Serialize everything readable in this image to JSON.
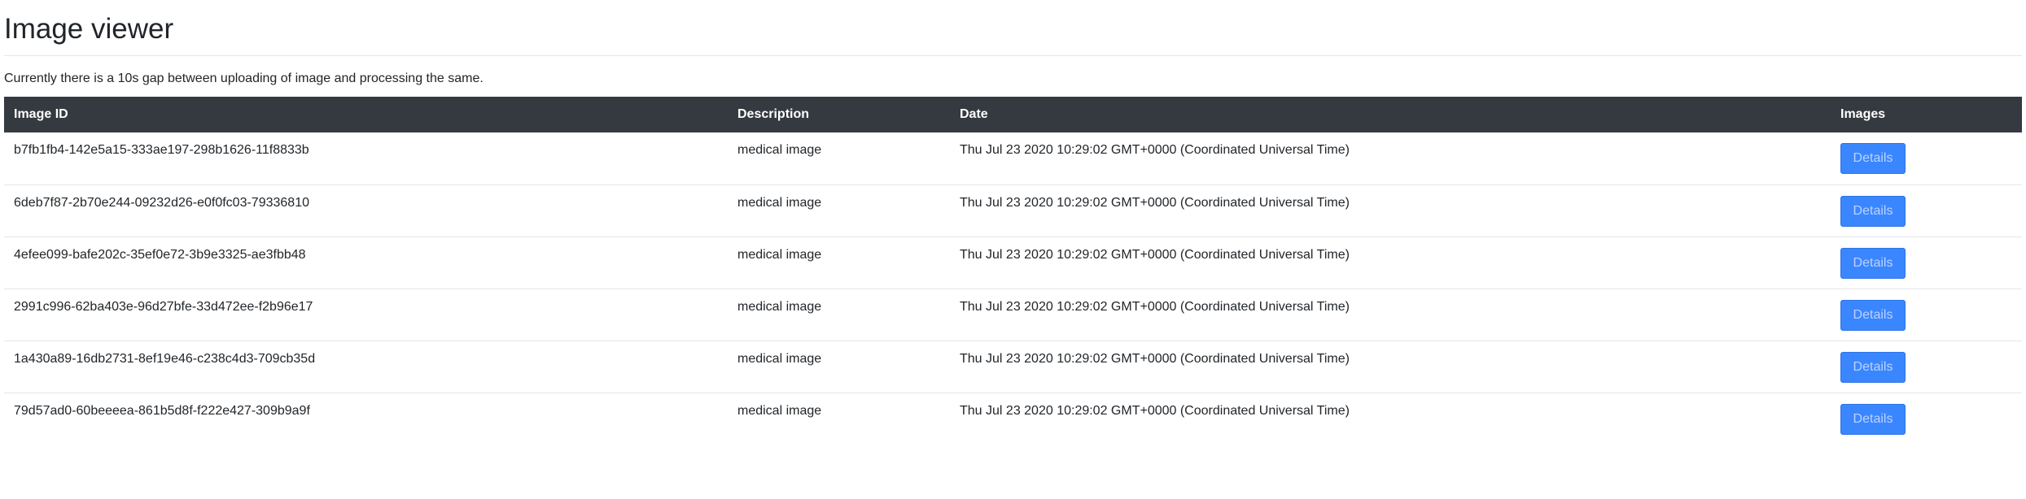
{
  "page": {
    "title": "Image viewer",
    "notice": "Currently there is a 10s gap between uploading of image and processing the same."
  },
  "table": {
    "headers": {
      "id": "Image ID",
      "description": "Description",
      "date": "Date",
      "images": "Images"
    },
    "rows": [
      {
        "id": "b7fb1fb4-142e5a15-333ae197-298b1626-11f8833b",
        "description": "medical image",
        "date": "Thu Jul 23 2020 10:29:02 GMT+0000 (Coordinated Universal Time)",
        "button": "Details"
      },
      {
        "id": "6deb7f87-2b70e244-09232d26-e0f0fc03-79336810",
        "description": "medical image",
        "date": "Thu Jul 23 2020 10:29:02 GMT+0000 (Coordinated Universal Time)",
        "button": "Details"
      },
      {
        "id": "4efee099-bafe202c-35ef0e72-3b9e3325-ae3fbb48",
        "description": "medical image",
        "date": "Thu Jul 23 2020 10:29:02 GMT+0000 (Coordinated Universal Time)",
        "button": "Details"
      },
      {
        "id": "2991c996-62ba403e-96d27bfe-33d472ee-f2b96e17",
        "description": "medical image",
        "date": "Thu Jul 23 2020 10:29:02 GMT+0000 (Coordinated Universal Time)",
        "button": "Details"
      },
      {
        "id": "1a430a89-16db2731-8ef19e46-c238c4d3-709cb35d",
        "description": "medical image",
        "date": "Thu Jul 23 2020 10:29:02 GMT+0000 (Coordinated Universal Time)",
        "button": "Details"
      },
      {
        "id": "79d57ad0-60beeeea-861b5d8f-f222e427-309b9a9f",
        "description": "medical image",
        "date": "Thu Jul 23 2020 10:29:02 GMT+0000 (Coordinated Universal Time)",
        "button": "Details"
      }
    ]
  },
  "colors": {
    "header_bg": "#343a40",
    "button_bg": "#3a86ff",
    "button_text": "#bcd3ff",
    "divider": "#e3e6ea"
  }
}
